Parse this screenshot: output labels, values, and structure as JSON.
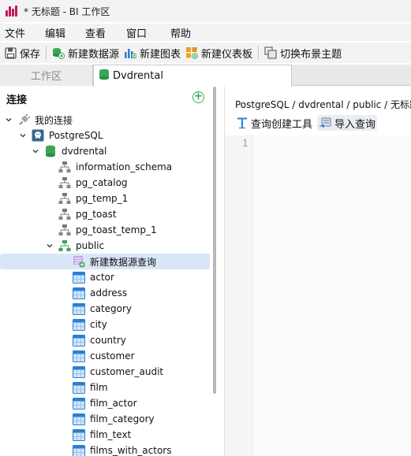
{
  "window": {
    "title": "* 无标题 - BI 工作区"
  },
  "menu": [
    "文件",
    "编辑",
    "查看",
    "窗口",
    "帮助"
  ],
  "toolbar": {
    "save": "保存",
    "new_datasource": "新建数据源",
    "new_chart": "新建图表",
    "new_dashboard": "新建仪表板",
    "switch_theme": "切换布景主题"
  },
  "tabs": {
    "workspace": "工作区",
    "dvdrental": "Dvdrental"
  },
  "panel": {
    "title": "连接"
  },
  "tree": {
    "my_connections": "我的连接",
    "postgresql": "PostgreSQL",
    "database": "dvdrental",
    "schemas": [
      "information_schema",
      "pg_catalog",
      "pg_temp_1",
      "pg_toast",
      "pg_toast_temp_1"
    ],
    "public": "public",
    "new_query": "新建数据源查询",
    "tables": [
      "actor",
      "address",
      "category",
      "city",
      "country",
      "customer",
      "customer_audit",
      "film",
      "film_actor",
      "film_category",
      "film_text",
      "films_with_actors"
    ]
  },
  "editor": {
    "breadcrumb": "PostgreSQL / dvdrental / public / 无标题",
    "query_builder": "查询创建工具",
    "import_query": "导入查询",
    "line_number": "1"
  },
  "colors": {
    "accent": "#c2185b",
    "selection": "#d8e6f7",
    "add": "#3aa655"
  }
}
